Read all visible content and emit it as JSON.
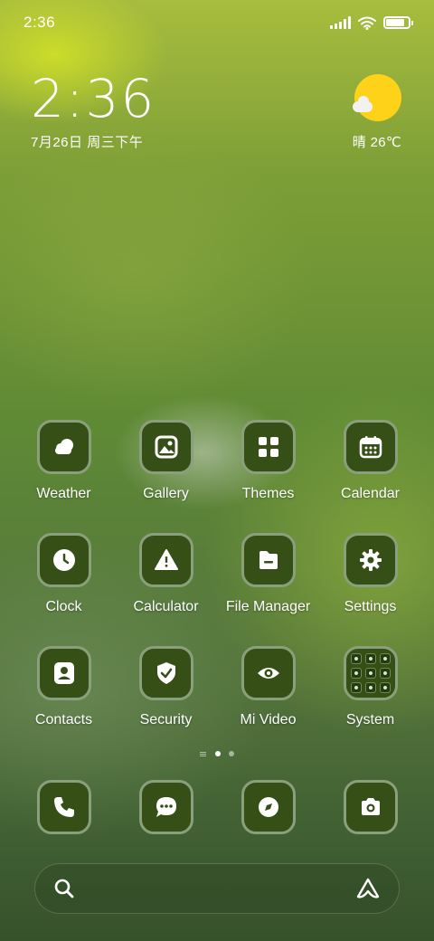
{
  "status_bar": {
    "time": "2:36",
    "signal_icon": "signal-icon",
    "wifi_icon": "wifi-icon",
    "battery_icon": "battery-icon",
    "battery_level": 0.85
  },
  "clock_widget": {
    "time": "2:36",
    "date": "7月26日 周三下午"
  },
  "weather_widget": {
    "icon": "partly-sunny-icon",
    "text": "晴 26℃"
  },
  "apps": [
    [
      {
        "label": "Weather",
        "icon": "weather-icon"
      },
      {
        "label": "Gallery",
        "icon": "gallery-icon"
      },
      {
        "label": "Themes",
        "icon": "themes-icon"
      },
      {
        "label": "Calendar",
        "icon": "calendar-icon"
      }
    ],
    [
      {
        "label": "Clock",
        "icon": "clock-icon"
      },
      {
        "label": "Calculator",
        "icon": "calculator-icon"
      },
      {
        "label": "File Manager",
        "icon": "file-manager-icon"
      },
      {
        "label": "Settings",
        "icon": "settings-icon"
      }
    ],
    [
      {
        "label": "Contacts",
        "icon": "contacts-icon"
      },
      {
        "label": "Security",
        "icon": "security-icon"
      },
      {
        "label": "Mi Video",
        "icon": "mi-video-icon"
      },
      {
        "label": "System",
        "icon": "folder-icon"
      }
    ]
  ],
  "page_indicator": {
    "pages": 2,
    "current": 1
  },
  "dock": [
    {
      "icon": "phone-icon"
    },
    {
      "icon": "messages-icon"
    },
    {
      "icon": "browser-icon"
    },
    {
      "icon": "camera-icon"
    }
  ],
  "search_bar": {
    "search_icon": "search-icon",
    "assistant_icon": "assistant-icon"
  },
  "colors": {
    "icon_bg": "#364f17",
    "icon_border": "#8aa07c",
    "sun": "#ffd21a"
  }
}
